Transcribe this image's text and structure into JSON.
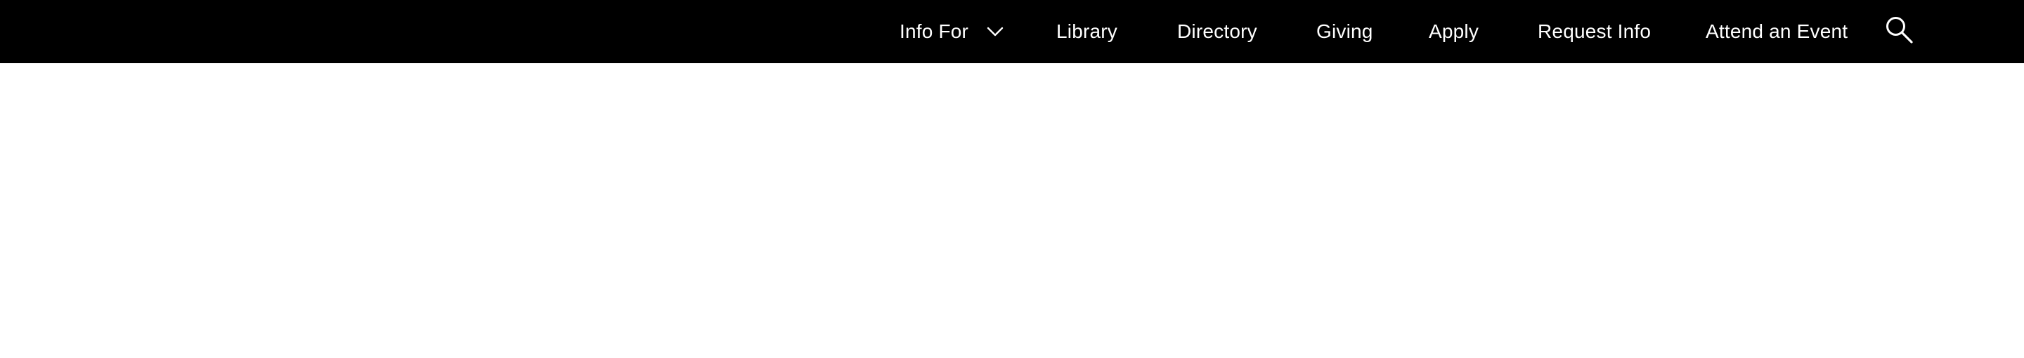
{
  "colors": {
    "header_bg": "#000000",
    "header_text": "#ffffff",
    "page_bg": "#ffffff"
  },
  "nav": {
    "info_for": {
      "label": "Info For",
      "icon": "chevron-down-icon"
    },
    "library": {
      "label": "Library"
    },
    "directory": {
      "label": "Directory"
    },
    "giving": {
      "label": "Giving"
    },
    "apply": {
      "label": "Apply"
    },
    "request_info": {
      "label": "Request Info"
    },
    "attend_event": {
      "label": "Attend an Event"
    },
    "search": {
      "icon": "search-icon"
    }
  }
}
